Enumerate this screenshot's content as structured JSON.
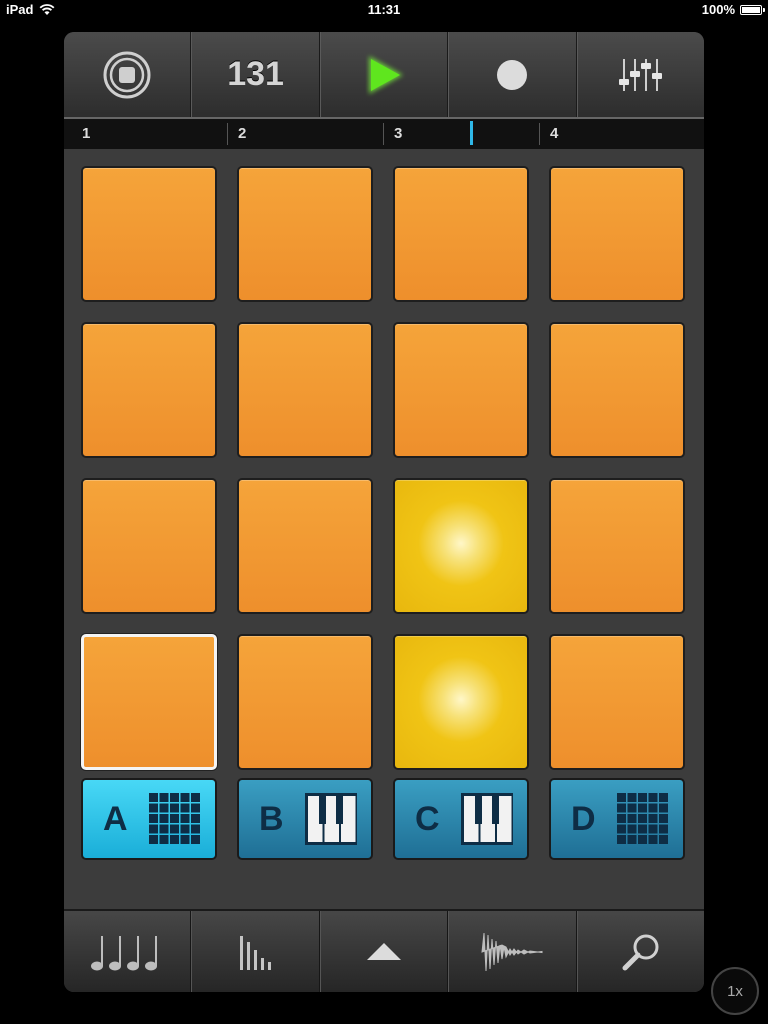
{
  "status_bar": {
    "device": "iPad",
    "time": "11:31",
    "battery": "100%",
    "battery_level": 1.0
  },
  "toolbar": {
    "bpm": "131",
    "icons": [
      "stop-icon",
      "play-icon",
      "record-icon",
      "mixer-icon"
    ],
    "play_color": "#5fe61e"
  },
  "timeline": {
    "bars": [
      "1",
      "2",
      "3",
      "4"
    ],
    "cursor_position_bars": 3.6,
    "cursor_color": "#2fb8e8"
  },
  "pads": {
    "rows": 4,
    "cols": 4,
    "lit": [
      10,
      14
    ],
    "selected": 12,
    "colors": {
      "idle": "#f09a33",
      "lit": "#f0c415"
    }
  },
  "banks": [
    {
      "letter": "A",
      "icon": "grid-icon",
      "active": true
    },
    {
      "letter": "B",
      "icon": "piano-icon",
      "active": false
    },
    {
      "letter": "C",
      "icon": "piano-icon",
      "active": false
    },
    {
      "letter": "D",
      "icon": "grid-icon",
      "active": false
    }
  ],
  "bottom_bar": {
    "icons": [
      "notes-icon",
      "levels-icon",
      "up-arrow-icon",
      "waveform-icon",
      "search-icon"
    ]
  },
  "zoom_button": {
    "label": "1x"
  }
}
